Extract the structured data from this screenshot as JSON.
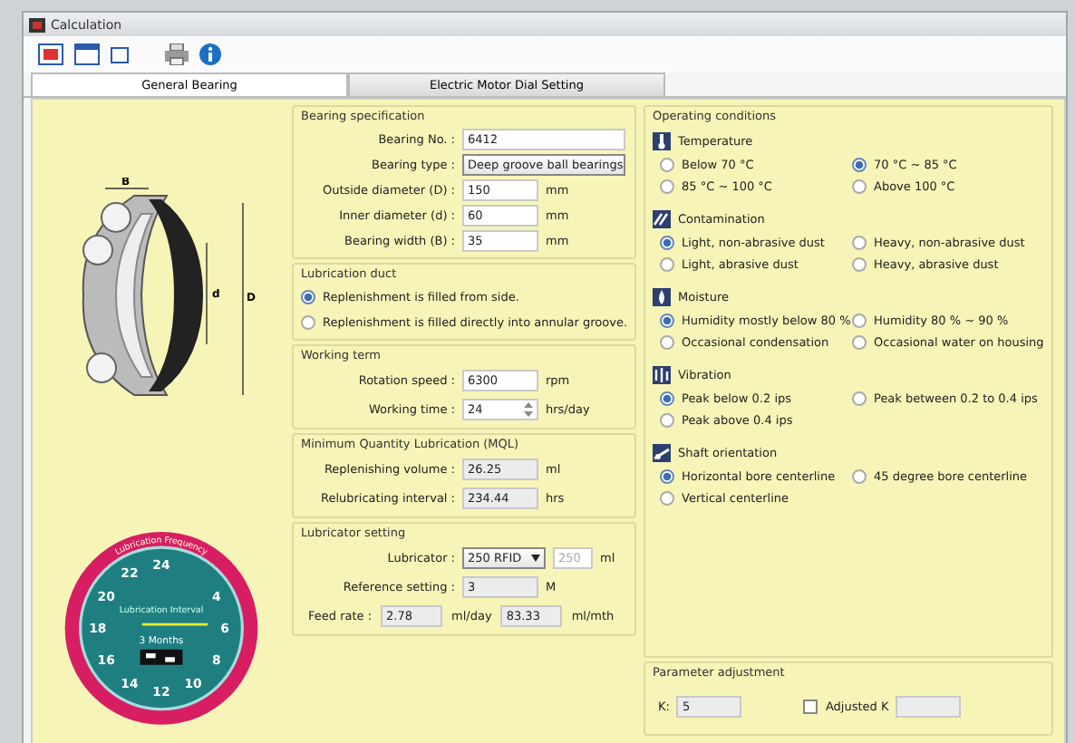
{
  "window": {
    "title": "Calculation"
  },
  "tabs": [
    {
      "label": "General Bearing",
      "selected": true
    },
    {
      "label": "Electric Motor Dial Setting",
      "selected": false
    }
  ],
  "diagram": {
    "labels": [
      "B",
      "d",
      "D"
    ]
  },
  "dial": {
    "ring_label": "Lubrication Frequency",
    "title": "Lubrication Interval",
    "numbers": [
      "22",
      "24",
      "4",
      "6",
      "8",
      "10",
      "12",
      "14",
      "16",
      "18",
      "20"
    ],
    "months": "3 Months"
  },
  "bearing_spec": {
    "title": "Bearing specification",
    "fields": [
      {
        "label": "Bearing No. :",
        "value": "6412",
        "kind": "text"
      },
      {
        "label": "Bearing type :",
        "value": "Deep groove ball bearings",
        "kind": "select"
      },
      {
        "label": "Outside diameter (D) :",
        "value": "150",
        "unit": "mm",
        "kind": "short"
      },
      {
        "label": "Inner diameter (d) :",
        "value": "60",
        "unit": "mm",
        "kind": "short"
      },
      {
        "label": "Bearing width (B) :",
        "value": "35",
        "unit": "mm",
        "kind": "short"
      }
    ]
  },
  "lubrication_duct": {
    "title": "Lubrication duct",
    "options": [
      {
        "label": "Replenishment is filled from side.",
        "selected": true
      },
      {
        "label": "Replenishment is filled directly into annular groove.",
        "selected": false
      }
    ]
  },
  "working_term": {
    "title": "Working term",
    "fields": [
      {
        "label": "Rotation speed :",
        "value": "6300",
        "unit": "rpm",
        "kind": "short"
      },
      {
        "label": "Working time :",
        "value": "24",
        "unit": "hrs/day",
        "kind": "spin"
      }
    ]
  },
  "mql": {
    "title": "Minimum Quantity Lubrication (MQL)",
    "fields": [
      {
        "label": "Replenishing volume :",
        "value": "26.25",
        "unit": "ml",
        "kind": "readonly"
      },
      {
        "label": "Relubricating interval :",
        "value": "234.44",
        "unit": "hrs",
        "kind": "readonly"
      }
    ]
  },
  "lubricator": {
    "title": "Lubricator setting",
    "lubricator_label": "Lubricator :",
    "lubricator_value": "250 RFID",
    "capacity": "250",
    "capacity_unit": "ml",
    "reference_label": "Reference setting :",
    "reference_value": "3",
    "reference_unit": "M",
    "feed_label": "Feed rate :",
    "feed_day": "2.78",
    "feed_day_unit": "ml/day",
    "feed_month": "83.33",
    "feed_month_unit": "ml/mth"
  },
  "operating": {
    "title": "Operating conditions",
    "groups": [
      {
        "title": "Temperature",
        "options": [
          {
            "label": "Below 70 °C",
            "selected": false
          },
          {
            "label": "70 °C ~ 85 °C",
            "selected": true
          },
          {
            "label": "85 °C ~ 100 °C",
            "selected": false
          },
          {
            "label": "Above 100 °C",
            "selected": false
          }
        ]
      },
      {
        "title": "Contamination",
        "options": [
          {
            "label": "Light, non-abrasive dust",
            "selected": true
          },
          {
            "label": "Heavy, non-abrasive dust",
            "selected": false
          },
          {
            "label": "Light, abrasive dust",
            "selected": false
          },
          {
            "label": "Heavy, abrasive dust",
            "selected": false
          }
        ]
      },
      {
        "title": "Moisture",
        "options": [
          {
            "label": "Humidity mostly below 80 %",
            "selected": true
          },
          {
            "label": "Humidity 80 % ~ 90 %",
            "selected": false
          },
          {
            "label": "Occasional condensation",
            "selected": false
          },
          {
            "label": "Occasional water on housing",
            "selected": false
          }
        ]
      },
      {
        "title": "Vibration",
        "options": [
          {
            "label": "Peak below 0.2 ips",
            "selected": true
          },
          {
            "label": "Peak between 0.2 to 0.4 ips",
            "selected": false
          },
          {
            "label": "Peak above 0.4 ips",
            "selected": false
          }
        ]
      },
      {
        "title": "Shaft orientation",
        "options": [
          {
            "label": "Horizontal bore centerline",
            "selected": true
          },
          {
            "label": "45 degree bore centerline",
            "selected": false
          },
          {
            "label": "Vertical centerline",
            "selected": false
          }
        ]
      }
    ]
  },
  "parameter": {
    "title": "Parameter adjustment",
    "k_label": "K:",
    "k_value": "5",
    "adjusted_label": "Adjusted K",
    "adjusted_checked": false
  }
}
